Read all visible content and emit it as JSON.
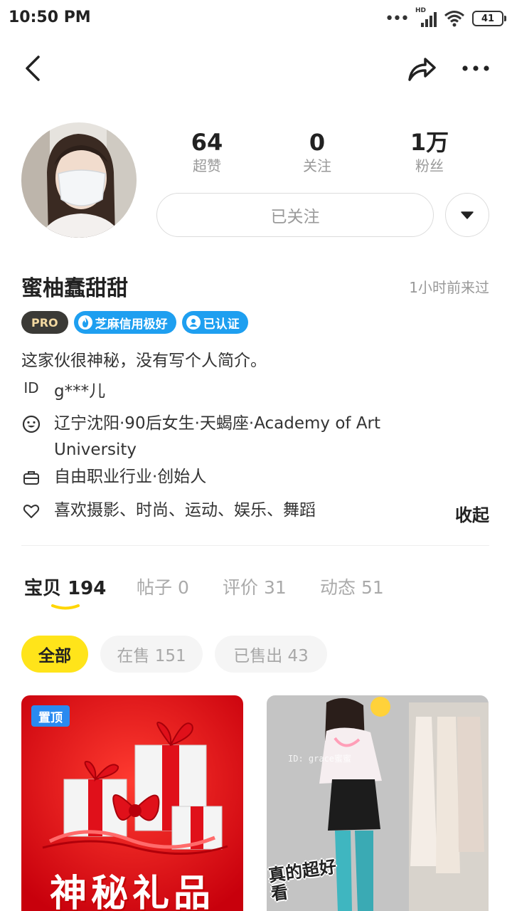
{
  "status_bar": {
    "time": "10:50 PM",
    "network_label": "HD",
    "battery": "41"
  },
  "profile": {
    "stats": [
      {
        "value": "64",
        "label": "超赞"
      },
      {
        "value": "0",
        "label": "关注"
      },
      {
        "value": "1万",
        "label": "粉丝"
      }
    ],
    "follow_label": "已关注",
    "name": "蜜柚蠢甜甜",
    "last_seen": "1小时前来过",
    "badges": {
      "pro": "PRO",
      "credit": "芝麻信用极好",
      "verified": "已认证"
    },
    "bio": "这家伙很神秘，没有写个人简介。",
    "id_label": "ID",
    "id_value": "g***儿",
    "info": {
      "personal": "辽宁沈阳·90后女生·天蝎座·Academy of Art University",
      "job": "自由职业行业·创始人",
      "hobbies": "喜欢摄影、时尚、运动、娱乐、舞蹈"
    },
    "collapse_label": "收起"
  },
  "tabs": [
    {
      "label": "宝贝",
      "count": "194"
    },
    {
      "label": "帖子",
      "count": "0"
    },
    {
      "label": "评价",
      "count": "31"
    },
    {
      "label": "动态",
      "count": "51"
    }
  ],
  "filters": [
    {
      "label": "全部"
    },
    {
      "label": "在售 151"
    },
    {
      "label": "已售出 43"
    }
  ],
  "cards": [
    {
      "tag": "置顶",
      "title": "神秘礼品"
    },
    {
      "watermark": "ID: grace蜜蜜",
      "caption": "真的超好看"
    }
  ],
  "colors": {
    "accent_yellow": "#ffe41a",
    "badge_blue": "#1e9ff0",
    "card_red": "#e0121a"
  }
}
